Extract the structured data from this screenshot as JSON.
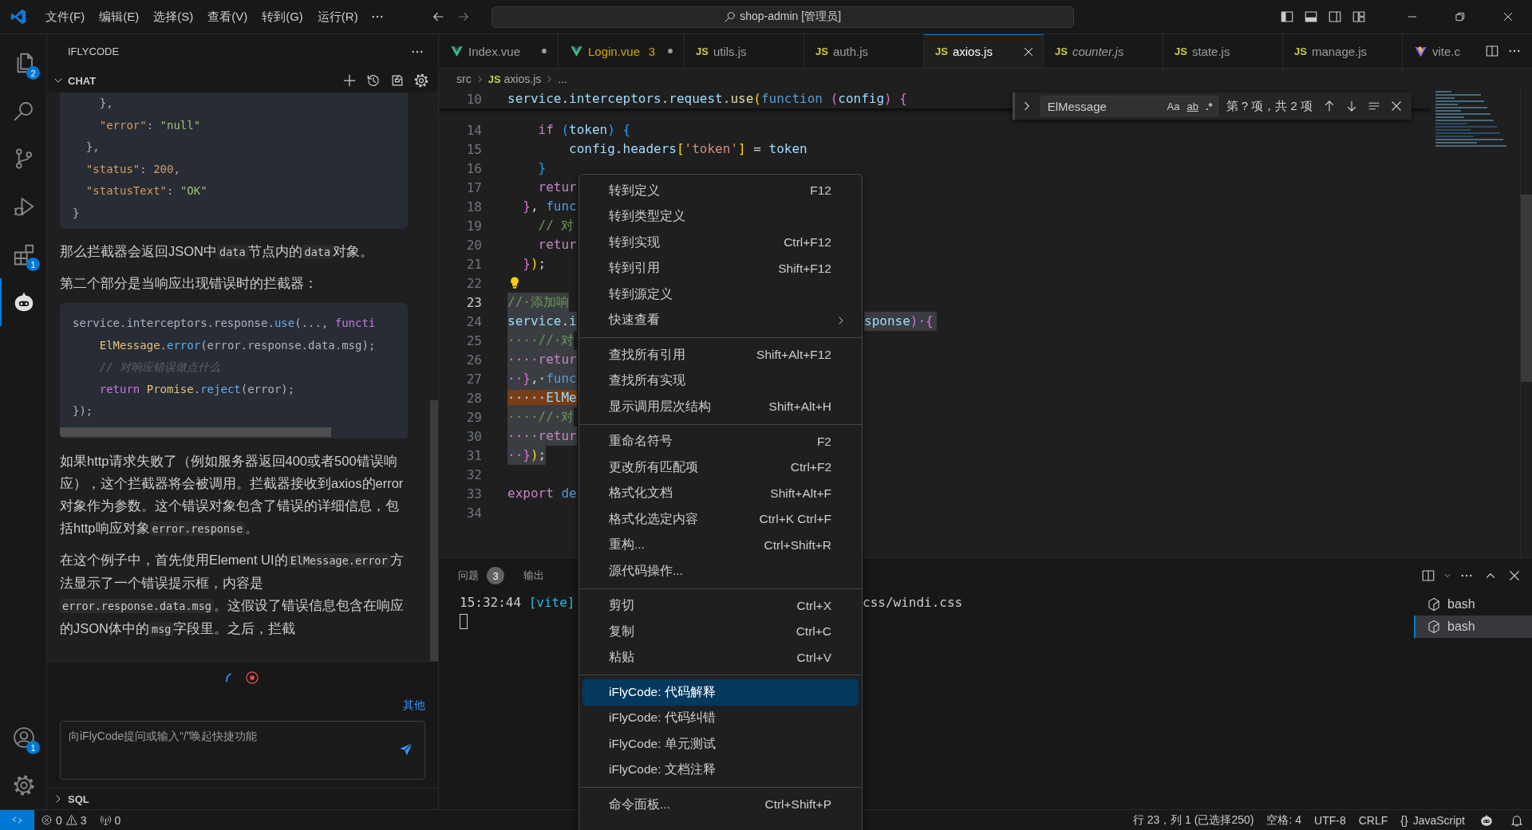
{
  "title_bar": {
    "menus": [
      "文件(F)",
      "编辑(E)",
      "选择(S)",
      "查看(V)",
      "转到(G)",
      "运行(R)"
    ],
    "search": "shop-admin [管理员]"
  },
  "activity_bar": {
    "items": [
      {
        "kind": "files",
        "badge": "2",
        "selected": false
      },
      {
        "kind": "search",
        "selected": false
      },
      {
        "kind": "source-control",
        "selected": false
      },
      {
        "kind": "run-debug",
        "selected": false
      },
      {
        "kind": "extensions",
        "badge": "1",
        "selected": false
      },
      {
        "kind": "robot",
        "selected": true
      }
    ],
    "bottom": [
      {
        "kind": "account",
        "badge": "1"
      },
      {
        "kind": "gear"
      }
    ]
  },
  "sidebar": {
    "title": "IFLYCODE",
    "section": {
      "label": "CHAT",
      "expanded": true
    },
    "chat": [
      {
        "kind": "code",
        "scrollable": false,
        "lines": [
          [
            {
              "text": "    },",
              "kind": "p"
            }
          ],
          [
            {
              "text": "    \"error\"",
              "kind": "key"
            },
            {
              "text": ": ",
              "kind": "p"
            },
            {
              "text": "\"null\"",
              "kind": "s"
            }
          ],
          [
            {
              "text": "  },",
              "kind": "p"
            }
          ],
          [
            {
              "text": "  \"status\"",
              "kind": "key"
            },
            {
              "text": ": ",
              "kind": "p"
            },
            {
              "text": "200",
              "kind": "n"
            },
            {
              "text": ",",
              "kind": "p"
            }
          ],
          [
            {
              "text": "  \"statusText\"",
              "kind": "key"
            },
            {
              "text": ": ",
              "kind": "p"
            },
            {
              "text": "\"OK\"",
              "kind": "s"
            }
          ],
          [
            {
              "text": "}",
              "kind": "p"
            }
          ]
        ]
      },
      {
        "kind": "paragraph",
        "segments": [
          {
            "text": "那么拦截器会返回JSON中",
            "kind": "text"
          },
          {
            "text": "data",
            "kind": "code"
          },
          {
            "text": "节点内的",
            "kind": "text"
          },
          {
            "text": "data",
            "kind": "code"
          },
          {
            "text": "对象。",
            "kind": "text"
          }
        ]
      },
      {
        "kind": "paragraph",
        "segments": [
          {
            "text": "第二个部分是当响应出现错误时的拦截器：",
            "kind": "text"
          }
        ]
      },
      {
        "kind": "code",
        "scrollable": true,
        "lines": [
          [
            {
              "text": "service.interceptors.response.",
              "kind": "p"
            },
            {
              "text": "use",
              "kind": "f"
            },
            {
              "text": "(..., ",
              "kind": "p"
            },
            {
              "text": "functi",
              "kind": "k"
            }
          ],
          [
            {
              "text": "    ElMessage",
              "kind": "t"
            },
            {
              "text": ".",
              "kind": "p"
            },
            {
              "text": "error",
              "kind": "f"
            },
            {
              "text": "(error.response.data.msg);",
              "kind": "p"
            }
          ],
          [
            {
              "text": "    // 对响应错误做点什么",
              "kind": "c"
            }
          ],
          [
            {
              "text": "    return",
              "kind": "k"
            },
            {
              "text": " Promise",
              "kind": "t"
            },
            {
              "text": ".",
              "kind": "p"
            },
            {
              "text": "reject",
              "kind": "f"
            },
            {
              "text": "(error);",
              "kind": "p"
            }
          ],
          [
            {
              "text": "});",
              "kind": "p"
            }
          ]
        ]
      },
      {
        "kind": "paragraph",
        "segments": [
          {
            "text": "如果http请求失败了（例如服务器返回400或者500错误响应），这个拦截器将会被调用。拦截器接收到axios的error对象作为参数。这个错误对象包含了错误的详细信息，包括http响应对象",
            "kind": "text"
          },
          {
            "text": "error.response",
            "kind": "code"
          },
          {
            "text": "。",
            "kind": "text"
          }
        ]
      },
      {
        "kind": "paragraph",
        "segments": [
          {
            "text": "在这个例子中，首先使用Element UI的",
            "kind": "text"
          },
          {
            "text": "ElMessage.error",
            "kind": "code"
          },
          {
            "text": "方法显示了一个错误提示框，内容是",
            "kind": "text"
          },
          {
            "text": "error.response.data.msg",
            "kind": "code"
          },
          {
            "text": "。这假设了错误信息包含在响应的JSON体中的",
            "kind": "text"
          },
          {
            "text": "msg",
            "kind": "code"
          },
          {
            "text": "字段里。之后，拦截",
            "kind": "text"
          }
        ]
      }
    ],
    "generating": true,
    "other_link": "其他",
    "input": {
      "placeholder": "向iFlyCode提问或输入“/”唤起快捷功能"
    },
    "footer_section": {
      "label": "SQL",
      "expanded": false
    }
  },
  "tabs": [
    {
      "kind": "vue",
      "label": "Index.vue",
      "modified": true,
      "selected": false,
      "italic": false
    },
    {
      "kind": "vue",
      "label": "Login.vue",
      "problems": "3",
      "modified": true,
      "selected": false,
      "italic": false
    },
    {
      "kind": "js",
      "icon_label": "JS",
      "label": "utils.js",
      "modified": false,
      "selected": false,
      "italic": false
    },
    {
      "kind": "js",
      "icon_label": "JS",
      "label": "auth.js",
      "modified": false,
      "selected": false,
      "italic": false
    },
    {
      "kind": "js",
      "icon_label": "JS",
      "label": "axios.js",
      "modified": false,
      "selected": true,
      "italic": false
    },
    {
      "kind": "js",
      "icon_label": "JS",
      "label": "counter.js",
      "modified": false,
      "selected": false,
      "italic": true
    },
    {
      "kind": "js",
      "icon_label": "JS",
      "label": "state.js",
      "modified": false,
      "selected": false,
      "italic": false
    },
    {
      "kind": "js",
      "icon_label": "JS",
      "label": "manage.js",
      "modified": false,
      "selected": false,
      "italic": false
    },
    {
      "kind": "vite",
      "label": "vite.c",
      "modified": false,
      "selected": false,
      "italic": false
    }
  ],
  "breadcrumb": [
    {
      "label": "src"
    },
    {
      "label": "axios.js",
      "icon_label": "JS"
    },
    {
      "label": "..."
    }
  ],
  "editor": {
    "sticky_line": {
      "number": "10",
      "segments": [
        {
          "text": "service",
          "kind": "v"
        },
        {
          "text": ".",
          "kind": "p"
        },
        {
          "text": "interceptors",
          "kind": "v"
        },
        {
          "text": ".",
          "kind": "p"
        },
        {
          "text": "request",
          "kind": "v"
        },
        {
          "text": ".",
          "kind": "p"
        },
        {
          "text": "use",
          "kind": "f"
        },
        {
          "text": "(",
          "kind": "b1"
        },
        {
          "text": "function",
          "kind": "kw"
        },
        {
          "text": " (",
          "kind": "b2"
        },
        {
          "text": "config",
          "kind": "v"
        },
        {
          "text": ")",
          "kind": "b2"
        },
        {
          "text": " {",
          "kind": "b2"
        }
      ]
    },
    "lines": [
      {
        "number": "14",
        "current": false,
        "selected": false,
        "segments": [
          {
            "text": "    if",
            "kind": "k"
          },
          {
            "text": " (",
            "kind": "b3"
          },
          {
            "text": "token",
            "kind": "v"
          },
          {
            "text": ")",
            "kind": "b3"
          },
          {
            "text": " {",
            "kind": "b3"
          }
        ]
      },
      {
        "number": "15",
        "current": false,
        "selected": false,
        "segments": [
          {
            "text": "        config",
            "kind": "v"
          },
          {
            "text": ".",
            "kind": "p"
          },
          {
            "text": "headers",
            "kind": "v"
          },
          {
            "text": "[",
            "kind": "b1"
          },
          {
            "text": "'token'",
            "kind": "s"
          },
          {
            "text": "]",
            "kind": "b1"
          },
          {
            "text": " = ",
            "kind": "p"
          },
          {
            "text": "token",
            "kind": "v"
          }
        ]
      },
      {
        "number": "16",
        "current": false,
        "selected": false,
        "segments": [
          {
            "text": "    }",
            "kind": "b3"
          }
        ]
      },
      {
        "number": "17",
        "current": false,
        "selected": false,
        "segments": [
          {
            "text": "    retur",
            "kind": "k"
          }
        ]
      },
      {
        "number": "18",
        "current": false,
        "selected": false,
        "segments": [
          {
            "text": "  }",
            "kind": "b2"
          },
          {
            "text": ", ",
            "kind": "p"
          },
          {
            "text": "func",
            "kind": "kw"
          }
        ]
      },
      {
        "number": "19",
        "current": false,
        "selected": false,
        "segments": [
          {
            "text": "    // 对",
            "kind": "c"
          }
        ]
      },
      {
        "number": "20",
        "current": false,
        "selected": false,
        "segments": [
          {
            "text": "    retur",
            "kind": "k"
          }
        ]
      },
      {
        "number": "21",
        "current": false,
        "selected": false,
        "segments": [
          {
            "text": "  }",
            "kind": "b2"
          },
          {
            "text": ")",
            "kind": "b1"
          },
          {
            "text": ";",
            "kind": "p"
          }
        ]
      },
      {
        "number": "22",
        "current": false,
        "lightbulb": true
      },
      {
        "number": "23",
        "current": true,
        "selected": true,
        "segments": [
          {
            "text": "//·添加响",
            "kind": "c"
          }
        ]
      },
      {
        "number": "24",
        "current": false,
        "selected": true,
        "segments": [
          {
            "text": "service",
            "kind": "v"
          },
          {
            "text": ".",
            "kind": "p"
          },
          {
            "text": "i",
            "kind": "v"
          }
        ],
        "after_menu": [
          {
            "text": "sponse",
            "kind": "v"
          },
          {
            "text": ")",
            "kind": "b2"
          },
          {
            "text": "·{",
            "kind": "b2"
          }
        ]
      },
      {
        "number": "25",
        "current": false,
        "selected": true,
        "segments": [
          {
            "text": "····//·对",
            "kind": "c"
          }
        ]
      },
      {
        "number": "26",
        "current": false,
        "selected": true,
        "segments": [
          {
            "text": "····retur",
            "kind": "k"
          }
        ]
      },
      {
        "number": "27",
        "current": false,
        "selected": true,
        "segments": [
          {
            "text": "··}",
            "kind": "b2"
          },
          {
            "text": ",·",
            "kind": "p"
          },
          {
            "text": "func",
            "kind": "kw"
          }
        ]
      },
      {
        "number": "28",
        "current": false,
        "selected": true,
        "segments": [
          {
            "text": "·····ElMe",
            "kind": "m"
          }
        ]
      },
      {
        "number": "29",
        "current": false,
        "selected": true,
        "segments": [
          {
            "text": "····//·对",
            "kind": "c"
          }
        ]
      },
      {
        "number": "30",
        "current": false,
        "selected": true,
        "segments": [
          {
            "text": "····retur",
            "kind": "k"
          }
        ]
      },
      {
        "number": "31",
        "current": false,
        "selected": true,
        "segments": [
          {
            "text": "··}",
            "kind": "b2"
          },
          {
            "text": ")",
            "kind": "b1"
          },
          {
            "text": ";",
            "kind": "p"
          }
        ]
      },
      {
        "number": "32",
        "current": false
      },
      {
        "number": "33",
        "current": false,
        "selected": false,
        "segments": [
          {
            "text": "export",
            "kind": "k"
          },
          {
            "text": " de",
            "kind": "kw"
          }
        ]
      },
      {
        "number": "34",
        "current": false
      }
    ],
    "find": {
      "query": "ElMessage",
      "toggles": [
        {
          "label": "Aa",
          "on": false
        },
        {
          "label": "ab",
          "on": false
        },
        {
          "label": ".*",
          "on": false
        }
      ],
      "result": "第 ? 项，共 2 项"
    }
  },
  "panel": {
    "tabs": [
      {
        "label": "问题",
        "badge": "3",
        "selected": false
      },
      {
        "label": "输出",
        "selected": false
      }
    ],
    "terminal_lines": [
      {
        "segments": [
          {
            "text": "15:32:44",
            "kind": "p"
          },
          {
            "text": " [vite]",
            "kind": "cyan"
          }
        ],
        "after_menu": [
          {
            "text": "css/windi.css",
            "kind": "p"
          }
        ]
      }
    ],
    "cursor": true,
    "terminals": [
      {
        "label": "bash",
        "selected": false
      },
      {
        "label": "bash",
        "selected": true
      }
    ]
  },
  "context_menu": {
    "groups": [
      [
        {
          "label": "转到定义",
          "shortcut": "F12",
          "submenu": false,
          "selected": false
        },
        {
          "label": "转到类型定义",
          "submenu": false,
          "selected": false
        },
        {
          "label": "转到实现",
          "shortcut": "Ctrl+F12",
          "submenu": false,
          "selected": false
        },
        {
          "label": "转到引用",
          "shortcut": "Shift+F12",
          "submenu": false,
          "selected": false
        },
        {
          "label": "转到源定义",
          "submenu": false,
          "selected": false
        },
        {
          "label": "快速查看",
          "submenu": true,
          "selected": false
        }
      ],
      [
        {
          "label": "查找所有引用",
          "shortcut": "Shift+Alt+F12",
          "submenu": false,
          "selected": false
        },
        {
          "label": "查找所有实现",
          "submenu": false,
          "selected": false
        },
        {
          "label": "显示调用层次结构",
          "shortcut": "Shift+Alt+H",
          "submenu": false,
          "selected": false
        }
      ],
      [
        {
          "label": "重命名符号",
          "shortcut": "F2",
          "submenu": false,
          "selected": false
        },
        {
          "label": "更改所有匹配项",
          "shortcut": "Ctrl+F2",
          "submenu": false,
          "selected": false
        },
        {
          "label": "格式化文档",
          "shortcut": "Shift+Alt+F",
          "submenu": false,
          "selected": false
        },
        {
          "label": "格式化选定内容",
          "shortcut": "Ctrl+K Ctrl+F",
          "submenu": false,
          "selected": false
        },
        {
          "label": "重构...",
          "shortcut": "Ctrl+Shift+R",
          "submenu": false,
          "selected": false
        },
        {
          "label": "源代码操作...",
          "submenu": false,
          "selected": false
        }
      ],
      [
        {
          "label": "剪切",
          "shortcut": "Ctrl+X",
          "submenu": false,
          "selected": false
        },
        {
          "label": "复制",
          "shortcut": "Ctrl+C",
          "submenu": false,
          "selected": false
        },
        {
          "label": "粘贴",
          "shortcut": "Ctrl+V",
          "submenu": false,
          "selected": false
        }
      ],
      [
        {
          "label": "iFlyCode: 代码解释",
          "submenu": false,
          "selected": true
        },
        {
          "label": "iFlyCode: 代码纠错",
          "submenu": false,
          "selected": false
        },
        {
          "label": "iFlyCode: 单元测试",
          "submenu": false,
          "selected": false
        },
        {
          "label": "iFlyCode: 文档注释",
          "submenu": false,
          "selected": false
        }
      ],
      [
        {
          "label": "命令面板...",
          "shortcut": "Ctrl+Shift+P",
          "submenu": false,
          "selected": false
        }
      ]
    ]
  },
  "status_bar": {
    "errors": "0",
    "warnings": "3",
    "ports": "0",
    "items": [
      {
        "label": "行 23，列 1 (已选择250)"
      },
      {
        "label": "空格: 4"
      },
      {
        "label": "UTF-8"
      },
      {
        "label": "CRLF"
      },
      {
        "icon_label": "{}",
        "label": "JavaScript"
      }
    ]
  }
}
